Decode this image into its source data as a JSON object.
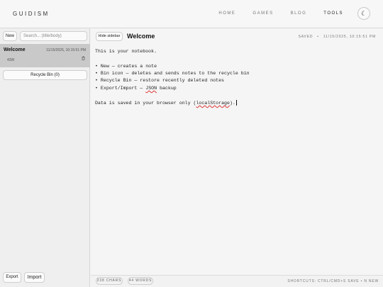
{
  "nav": {
    "brand": "GUIDISM",
    "links": [
      "HOME",
      "GAMES",
      "BLOG",
      "TOOLS"
    ],
    "theme_icon": "☾"
  },
  "sidebar": {
    "new_label": "New",
    "search_placeholder": "Search... (title/body)",
    "notes": [
      {
        "title": "Welcome",
        "date": "11/15/2025, 10:15:51 PM",
        "words": "43W"
      }
    ],
    "recycle_label": "Recycle Bin (0)",
    "export_label": "Export",
    "import_label": "Import"
  },
  "main": {
    "hide_sidebar_label": "Hide sidebar",
    "title": "Welcome",
    "saved_label": "SAVED",
    "saved_sep": "•",
    "saved_time": "11/15/2025, 10:15:51 PM",
    "body_lines": [
      "This is your notebook.",
      "",
      "• New — creates a note",
      "• Bin icon — deletes and sends notes to the recycle bin",
      "• Recycle Bin — restore recently deleted notes",
      "• Export/Import — JSON backup",
      "",
      "Data is saved in your browser only (localStorage)."
    ],
    "chars": "238 CHARS",
    "words": "44 WORDS",
    "shortcuts": "SHORTCUTS: CTRL/CMD+S SAVE • N NEW"
  }
}
